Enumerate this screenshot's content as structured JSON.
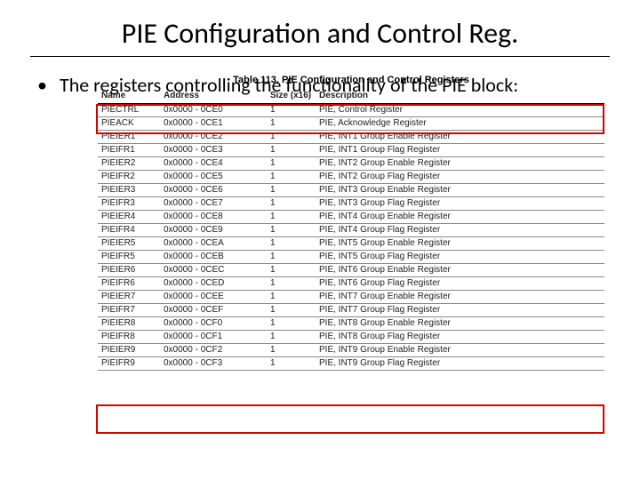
{
  "title": "PIE Configuration and Control Reg.",
  "bullet": "The registers controlling the functionality of the PIE block:",
  "table_caption": "Table 113. PIE Configuration and Control Registers",
  "headers": {
    "name": "Name",
    "address": "Address",
    "size": "Size (x16)",
    "desc": "Description"
  },
  "rows": [
    {
      "name": "PIECTRL",
      "addr": "0x0000 - 0CE0",
      "size": "1",
      "desc": "PIE, Control Register"
    },
    {
      "name": "PIEACK",
      "addr": "0x0000 - 0CE1",
      "size": "1",
      "desc": "PIE, Acknowledge Register"
    },
    {
      "name": "PIEIER1",
      "addr": "0x0000 - 0CE2",
      "size": "1",
      "desc": "PIE, INT1 Group Enable Register"
    },
    {
      "name": "PIEIFR1",
      "addr": "0x0000 - 0CE3",
      "size": "1",
      "desc": "PIE, INT1 Group Flag Register"
    },
    {
      "name": "PIEIER2",
      "addr": "0x0000 - 0CE4",
      "size": "1",
      "desc": "PIE, INT2 Group Enable Register"
    },
    {
      "name": "PIEIFR2",
      "addr": "0x0000 - 0CE5",
      "size": "1",
      "desc": "PIE, INT2 Group Flag Register"
    },
    {
      "name": "PIEIER3",
      "addr": "0x0000 - 0CE6",
      "size": "1",
      "desc": "PIE, INT3 Group Enable Register"
    },
    {
      "name": "PIEIFR3",
      "addr": "0x0000 - 0CE7",
      "size": "1",
      "desc": "PIE, INT3 Group Flag Register"
    },
    {
      "name": "PIEIER4",
      "addr": "0x0000 - 0CE8",
      "size": "1",
      "desc": "PIE, INT4 Group Enable Register"
    },
    {
      "name": "PIEIFR4",
      "addr": "0x0000 - 0CE9",
      "size": "1",
      "desc": "PIE, INT4 Group Flag Register"
    },
    {
      "name": "PIEIER5",
      "addr": "0x0000 - 0CEA",
      "size": "1",
      "desc": "PIE, INT5 Group Enable Register"
    },
    {
      "name": "PIEIFR5",
      "addr": "0x0000 - 0CEB",
      "size": "1",
      "desc": "PIE, INT5 Group Flag Register"
    },
    {
      "name": "PIEIER6",
      "addr": "0x0000 - 0CEC",
      "size": "1",
      "desc": "PIE, INT6 Group Enable Register"
    },
    {
      "name": "PIEIFR6",
      "addr": "0x0000 - 0CED",
      "size": "1",
      "desc": "PIE, INT6 Group Flag Register"
    },
    {
      "name": "PIEIER7",
      "addr": "0x0000 - 0CEE",
      "size": "1",
      "desc": "PIE, INT7 Group Enable Register"
    },
    {
      "name": "PIEIFR7",
      "addr": "0x0000 - 0CEF",
      "size": "1",
      "desc": "PIE, INT7 Group Flag Register"
    },
    {
      "name": "PIEIER8",
      "addr": "0x0000 - 0CF0",
      "size": "1",
      "desc": "PIE, INT8 Group Enable Register"
    },
    {
      "name": "PIEIFR8",
      "addr": "0x0000 - 0CF1",
      "size": "1",
      "desc": "PIE, INT8 Group Flag Register"
    },
    {
      "name": "PIEIER9",
      "addr": "0x0000 - 0CF2",
      "size": "1",
      "desc": "PIE, INT9 Group Enable Register"
    },
    {
      "name": "PIEIFR9",
      "addr": "0x0000 - 0CF3",
      "size": "1",
      "desc": "PIE, INT9 Group Flag Register"
    }
  ]
}
